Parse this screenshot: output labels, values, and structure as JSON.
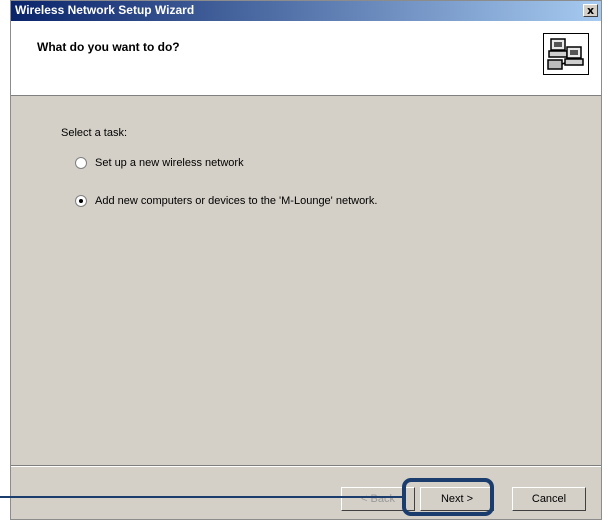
{
  "window": {
    "title": "Wireless Network Setup Wizard",
    "close_label": "x"
  },
  "header": {
    "title": "What do you want to do?"
  },
  "content": {
    "prompt": "Select a task:",
    "options": [
      {
        "label": "Set up a new wireless network",
        "selected": false
      },
      {
        "label": "Add new computers or devices to the 'M-Lounge' network.",
        "selected": true
      }
    ]
  },
  "buttons": {
    "back": "< Back",
    "next": "Next >",
    "cancel": "Cancel"
  },
  "colors": {
    "title_bar_start": "#0a246a",
    "title_bar_end": "#a6caf0",
    "dialog_bg": "#d4d0c8",
    "highlight": "#1a3d6e"
  },
  "icons": {
    "wizard": "network-computers-icon",
    "close": "close-icon"
  }
}
